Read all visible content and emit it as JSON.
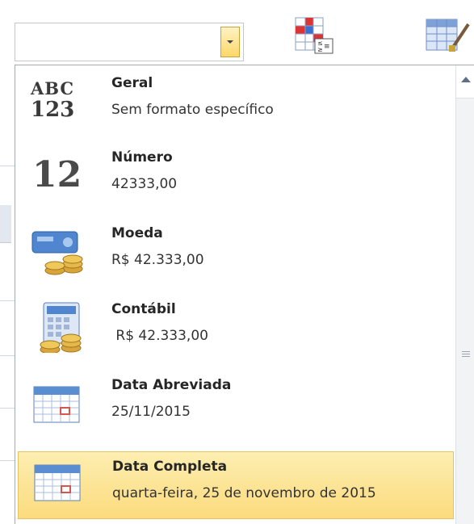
{
  "number_format": {
    "current_value": "",
    "items": [
      {
        "name": "Geral",
        "example": "Sem formato específico",
        "icon": "abc-123-icon",
        "icon_text_top": "ABC",
        "icon_text_bottom": "123"
      },
      {
        "name": "Número",
        "example": "42333,00",
        "icon": "number-12-icon",
        "icon_text": "12"
      },
      {
        "name": "Moeda",
        "example": "R$ 42.333,00",
        "icon": "currency-icon"
      },
      {
        "name": "Contábil",
        "example": " R$ 42.333,00",
        "icon": "accounting-icon"
      },
      {
        "name": "Data Abreviada",
        "example": "25/11/2015",
        "icon": "calendar-icon"
      },
      {
        "name": "Data Completa",
        "example": "quarta-feira, 25 de novembro de 2015",
        "icon": "calendar-icon",
        "highlighted": true
      }
    ]
  },
  "colors": {
    "highlight": "#fbdb7d",
    "calendar_header": "#5a8ed1",
    "calendar_mark": "#d9534f"
  }
}
